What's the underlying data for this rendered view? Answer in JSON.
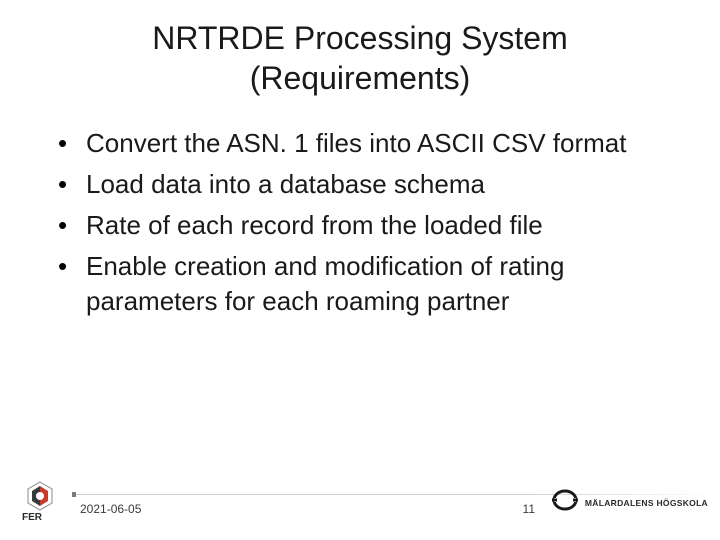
{
  "title_line1": "NRTRDE Processing System",
  "title_line2": "(Requirements)",
  "bullets": [
    "Convert the ASN. 1 files into ASCII CSV format",
    "Load data into a database schema",
    "Rate of each record from the loaded file",
    "Enable creation and modification of rating parameters for each roaming partner"
  ],
  "footer": {
    "date": "2021-06-05",
    "page": "11",
    "right_logo_text": "MÄLARDALENS HÖGSKOLA"
  }
}
